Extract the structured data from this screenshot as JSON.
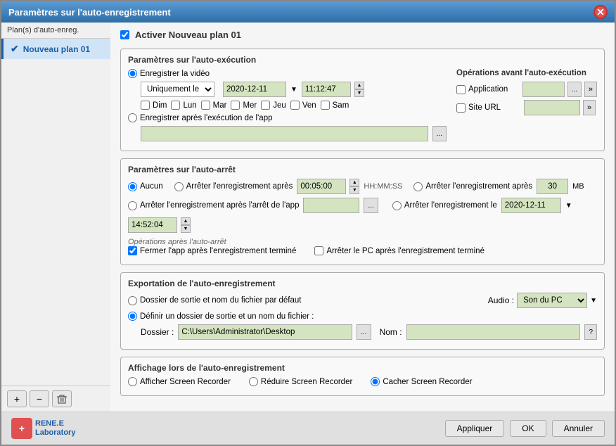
{
  "window": {
    "title": "Paramètres sur l'auto-enregistrement",
    "close_label": "✕"
  },
  "sidebar": {
    "header": "Plan(s) d'auto-enreg.",
    "item": {
      "label": "Nouveau plan 01",
      "checked": true
    },
    "add_btn": "+",
    "remove_btn": "−",
    "delete_btn": "🗑"
  },
  "plan": {
    "activate_label": "Activer Nouveau plan 01",
    "section_execution": {
      "title": "Paramètres sur l'auto-exécution",
      "record_video_label": "Enregistrer la vidéo",
      "dropdown_value": "Uniquement le",
      "date_value": "2020-12-11",
      "time_value": "11:12:47",
      "days": [
        "Dim",
        "Lun",
        "Mar",
        "Mer",
        "Jeu",
        "Ven",
        "Sam"
      ],
      "execute_after_label": "Enregistrer après l'exécution de l'app",
      "ops_title": "Opérations avant l'auto-exécution",
      "app_label": "Application",
      "site_url_label": "Site URL",
      "dots_btn": "...",
      "arrow_btn": "»"
    },
    "section_stop": {
      "title": "Paramètres sur l'auto-arrêt",
      "none_label": "Aucun",
      "stop_after_label": "Arrêter l'enregistrement après",
      "stop_duration_value": "00:05:00",
      "hhmm_label": "HH:MM:SS",
      "stop_after_mb_label": "Arrêter l'enregistrement après",
      "mb_value": "30",
      "mb_unit": "MB",
      "stop_after_app_label": "Arrêter l'enregistrement après l'arrêt de l'app",
      "stop_on_date_label": "Arrêter l'enregistrement le",
      "stop_date_value": "2020-12-11",
      "stop_time_value": "14:52:04",
      "ops_after_title": "Opérations après l'auto-arrêt",
      "close_app_label": "Fermer l'app après l'enregistrement terminé",
      "shutdown_label": "Arrêter le PC après l'enregistrement terminé",
      "dots_btn": "..."
    },
    "section_export": {
      "title": "Exportation de l'auto-enregistrement",
      "default_folder_label": "Dossier de sortie et nom du fichier par défaut",
      "custom_folder_label": "Définir un dossier de sortie et un nom du fichier :",
      "folder_label": "Dossier :",
      "folder_value": "C:\\Users\\Administrator\\Desktop",
      "name_label": "Nom :",
      "dots_btn": "...",
      "question_btn": "?",
      "audio_label": "Audio :",
      "audio_value": "Son du PC"
    },
    "section_display": {
      "title": "Affichage lors de l'auto-enregistrement",
      "show_label": "Afficher Screen Recorder",
      "reduce_label": "Réduire Screen Recorder",
      "hide_label": "Cacher Screen Recorder"
    }
  },
  "footer": {
    "apply_label": "Appliquer",
    "ok_label": "OK",
    "cancel_label": "Annuler",
    "logo_text_line1": "RENE.E",
    "logo_text_line2": "Laboratory"
  }
}
